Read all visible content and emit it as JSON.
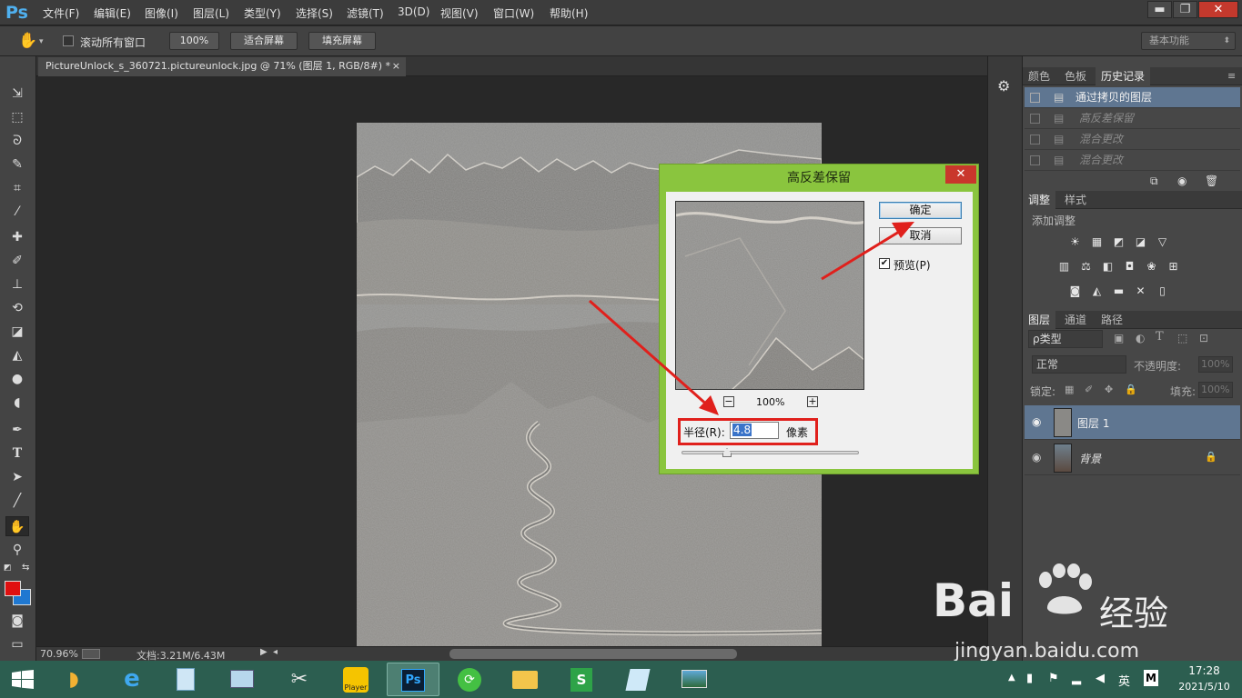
{
  "app": {
    "logo": "Ps",
    "menus": [
      "文件(F)",
      "编辑(E)",
      "图像(I)",
      "图层(L)",
      "类型(Y)",
      "选择(S)",
      "滤镜(T)",
      "3D(D)",
      "视图(V)",
      "窗口(W)",
      "帮助(H)"
    ],
    "window_controls": {
      "minimize": "▬",
      "restore": "❐",
      "close": "✕"
    }
  },
  "options": {
    "scroll_all": "滚动所有窗口",
    "zoom_100": "100%",
    "fit_screen": "适合屏幕",
    "fill_screen": "填充屏幕",
    "workspace": "基本功能"
  },
  "document": {
    "tab_title": "PictureUnlock_s_360721.pictureunlock.jpg @ 71% (图层 1, RGB/8#) *",
    "close": "×"
  },
  "status": {
    "zoom": "70.96%",
    "doc_info": "文档:3.21M/6.43M"
  },
  "history_panel": {
    "tabs": [
      "颜色",
      "色板",
      "历史记录"
    ],
    "items": [
      "通过拷贝的图层",
      "高反差保留",
      "混合更改",
      "混合更改"
    ]
  },
  "adjust_panel": {
    "tabs": [
      "调整",
      "样式"
    ],
    "title": "添加调整"
  },
  "layers_panel": {
    "tabs": [
      "图层",
      "通道",
      "路径"
    ],
    "filter": "ρ类型",
    "blend_mode": "正常",
    "opacity_label": "不透明度:",
    "opacity_value": "100%",
    "lock_label": "锁定:",
    "fill_label": "填充:",
    "fill_value": "100%",
    "layers": [
      {
        "name": "图层 1"
      },
      {
        "name": "背景"
      }
    ]
  },
  "dialog": {
    "title": "高反差保留",
    "ok": "确定",
    "cancel": "取消",
    "preview_label": "预览(P)",
    "preview_zoom": "100%",
    "radius_label": "半径(R):",
    "radius_value": "4.8",
    "unit": "像素",
    "minus": "−",
    "plus": "+",
    "close": "✕"
  },
  "taskbar": {
    "clock_time": "17:28",
    "clock_date": "2021/5/10",
    "ime": "英",
    "ime2": "M",
    "player_label": "Player"
  },
  "watermark": {
    "brand": "Bai",
    "brand_tail": "经验",
    "url": "jingyan.baidu.com"
  },
  "colors": {
    "accent": "#8ac53e",
    "annotation": "#e0201c",
    "foreground": "#e01010",
    "background": "#1f78d1"
  }
}
